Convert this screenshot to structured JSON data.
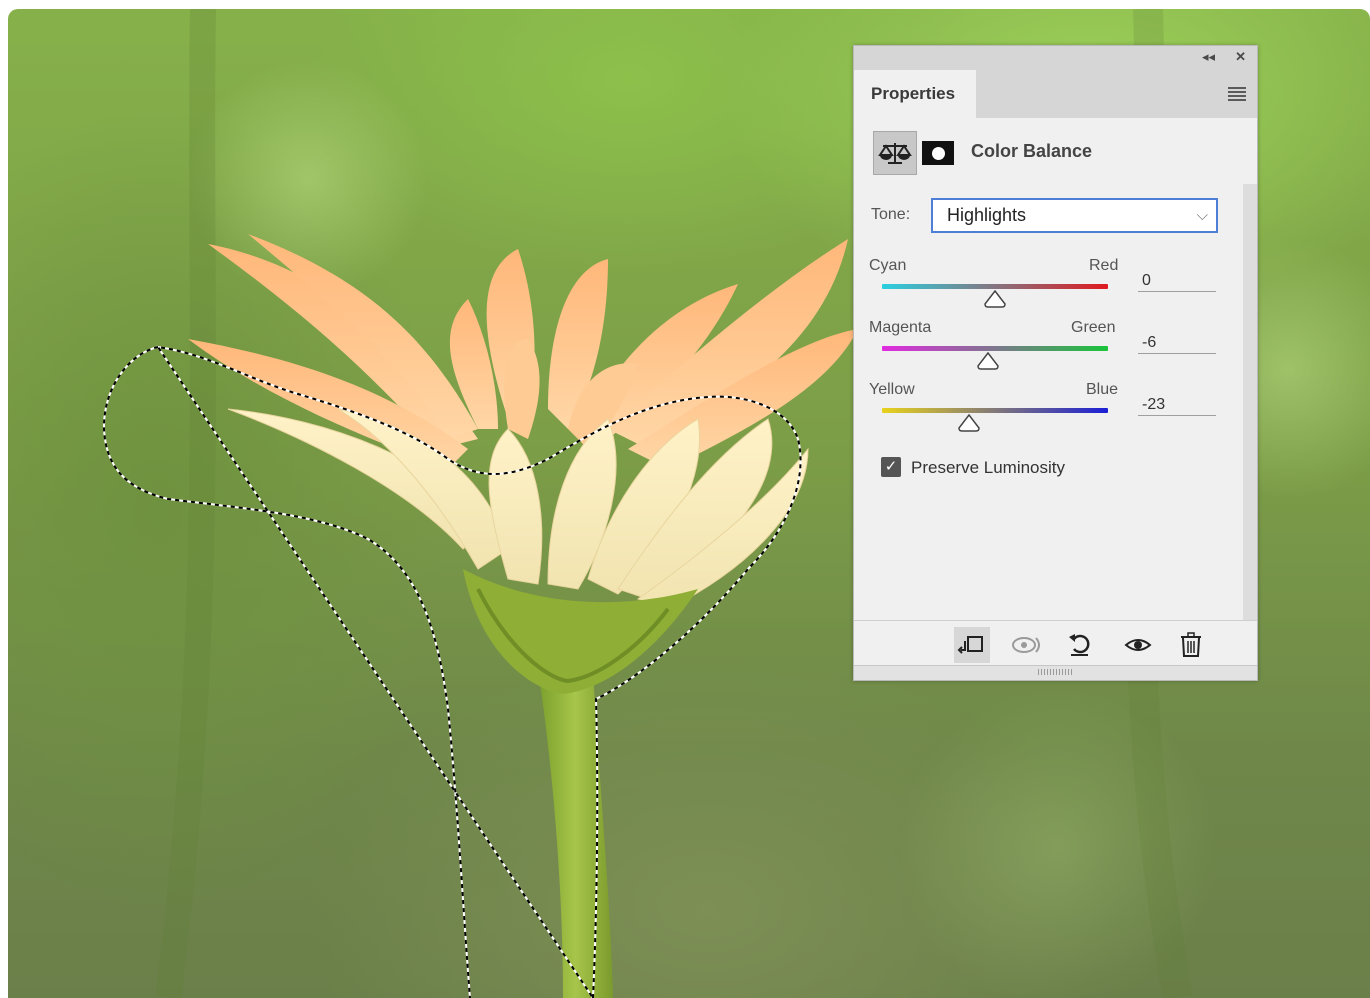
{
  "panel": {
    "tab_label": "Properties",
    "adjustment_title": "Color Balance",
    "tone": {
      "label": "Tone:",
      "value": "Highlights"
    },
    "sliders": [
      {
        "left_label": "Cyan",
        "right_label": "Red",
        "value": "0",
        "level": 0.5,
        "gradient": [
          "#2ad0e0",
          "#e0191f"
        ]
      },
      {
        "left_label": "Magenta",
        "right_label": "Green",
        "value": "-6",
        "level": 0.47,
        "gradient": [
          "#e12ae0",
          "#19c43a"
        ]
      },
      {
        "left_label": "Yellow",
        "right_label": "Blue",
        "value": "-23",
        "level": 0.385,
        "gradient": [
          "#e8d21c",
          "#1b1fd6"
        ]
      }
    ],
    "preserve_luminosity": {
      "label": "Preserve Luminosity",
      "checked": true
    },
    "bottom_icons": [
      "clip-to-layer-icon",
      "view-previous-state-icon",
      "reset-icon",
      "visibility-eye-icon",
      "delete-trash-icon"
    ]
  },
  "colors": {
    "panel_bg": "#f0f0f0",
    "accent": "#4d7fd6",
    "petal": "#f7b27a",
    "stem": "#8db33a"
  }
}
